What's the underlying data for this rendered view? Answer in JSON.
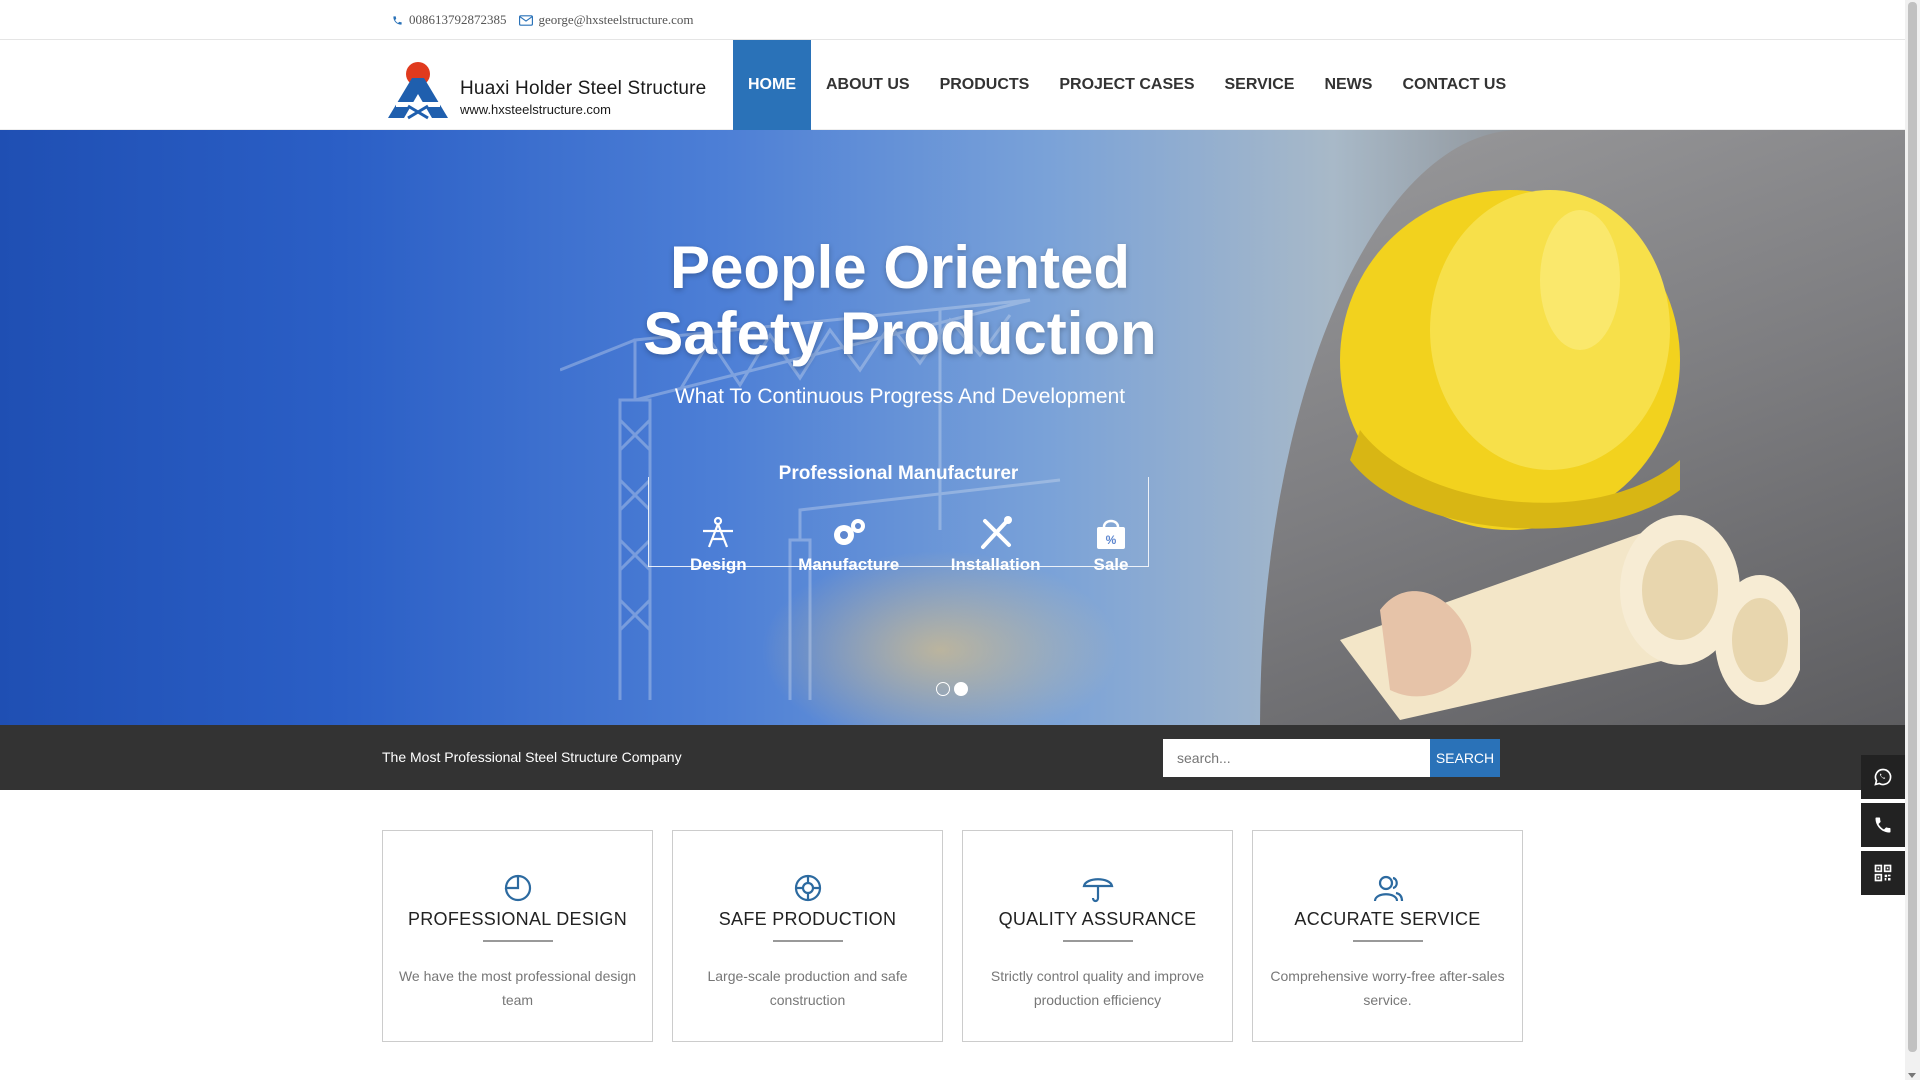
{
  "topbar": {
    "phone": "008613792872385",
    "email": "george@hxsteelstructure.com"
  },
  "logo": {
    "title": "Huaxi Holder Steel Structure",
    "url": "www.hxsteelstructure.com"
  },
  "nav": {
    "items": [
      {
        "label": "HOME",
        "active": true
      },
      {
        "label": "ABOUT US"
      },
      {
        "label": "PRODUCTS"
      },
      {
        "label": "PROJECT CASES"
      },
      {
        "label": "SERVICE"
      },
      {
        "label": "NEWS"
      },
      {
        "label": "CONTACT US"
      }
    ]
  },
  "hero": {
    "title_line1": "People Oriented",
    "title_line2": "Safety Production",
    "subtitle": "What To Continuous Progress And Development",
    "box_label": "Professional Manufacturer",
    "items": [
      "Design",
      "Manufacture",
      "Installation",
      "Sale"
    ],
    "slide_count": 2,
    "active_slide": 2
  },
  "tagbar": {
    "tagline": "The Most Professional Steel Structure Company",
    "search_placeholder": "search...",
    "search_button": "SEARCH"
  },
  "features": [
    {
      "icon": "pie-chart-icon",
      "title": "PROFESSIONAL DESIGN",
      "desc": "We have the most professional design team"
    },
    {
      "icon": "lifebuoy-icon",
      "title": "SAFE PRODUCTION",
      "desc": "Large-scale production and safe construction"
    },
    {
      "icon": "umbrella-icon",
      "title": "QUALITY ASSURANCE",
      "desc": "Strictly control quality and improve production efficiency"
    },
    {
      "icon": "users-icon",
      "title": "ACCURATE SERVICE",
      "desc": "Comprehensive worry-free after-sales service."
    }
  ],
  "side_float": [
    "whatsapp-icon",
    "phone-icon",
    "qr-code-icon"
  ],
  "colors": {
    "accent": "#2a72b8",
    "dark_bar": "#333333",
    "icon_blue": "#2c6aa0"
  }
}
